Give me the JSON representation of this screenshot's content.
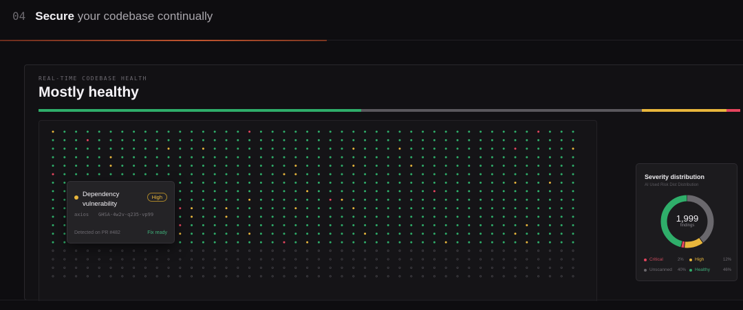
{
  "section": {
    "number": "04",
    "title_bold": "Secure",
    "title_rest": " your codebase continually",
    "progress": 0.44
  },
  "panel": {
    "eyebrow": "REAL-TIME CODEBASE HEALTH",
    "title": "Mostly healthy",
    "health_bar": [
      {
        "name": "healthy",
        "fraction": 0.46,
        "color": "#2fae6a"
      },
      {
        "name": "unscanned",
        "fraction": 0.4,
        "color": "#5a585d"
      },
      {
        "name": "high",
        "fraction": 0.12,
        "color": "#e8b63c"
      },
      {
        "name": "critical",
        "fraction": 0.02,
        "color": "#e5455e"
      }
    ]
  },
  "tooltip": {
    "title": "Dependency vulnerability",
    "badge": "High",
    "package": "axios",
    "advisory": "GHSA-4w2v-q235-vp99",
    "detected": "Detected on PR #482",
    "fix": "Fix ready"
  },
  "severity": {
    "title": "Severity distribution",
    "subtitle": "AI Used Risk Dist Distribution",
    "total": "1,999",
    "total_unit": "findings",
    "legend": [
      {
        "label": "Critical",
        "pct": "2%",
        "value": 2,
        "color": "#e5455e"
      },
      {
        "label": "High",
        "pct": "12%",
        "value": 12,
        "color": "#e8b63c"
      },
      {
        "label": "Unscanned",
        "pct": "40%",
        "value": 40,
        "color": "#6a686d"
      },
      {
        "label": "Healthy",
        "pct": "46%",
        "value": 46,
        "color": "#2fae6a"
      }
    ]
  },
  "colors": {
    "healthy": "#2fae6a",
    "high": "#e8b63c",
    "critical": "#e5455e",
    "unscanned": "#6a686d"
  }
}
